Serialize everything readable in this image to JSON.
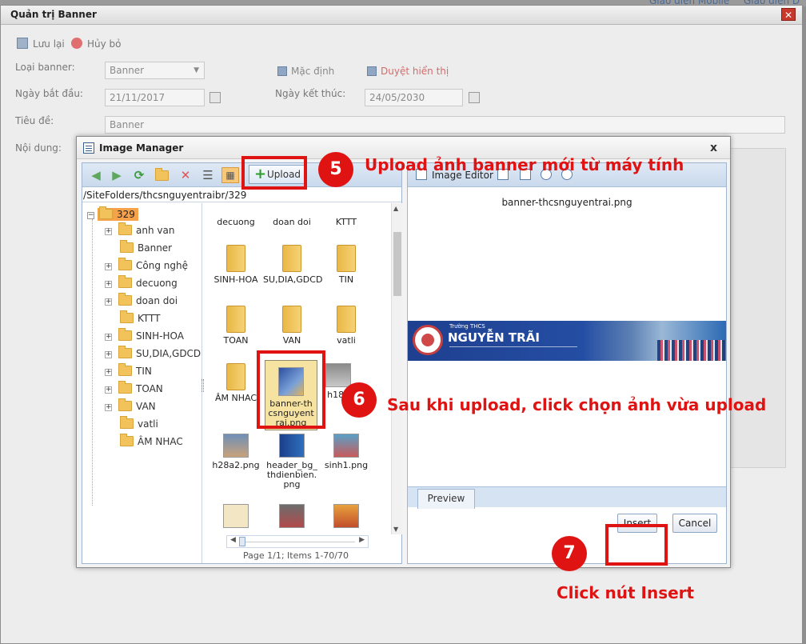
{
  "page": {
    "top_links": [
      "Giao diện Mobile",
      "Giao diện D"
    ]
  },
  "window": {
    "title": "Quản trị Banner",
    "close_glyph": "✕"
  },
  "toolbar": {
    "save_label": "Lưu lại",
    "cancel_label": "Hủy bỏ"
  },
  "form": {
    "banner_type_label": "Loại banner:",
    "banner_type_value": "Banner",
    "default_label": "Mặc định",
    "approve_label": "Duyệt hiển thị",
    "start_date_label": "Ngày bắt đầu:",
    "start_date_value": "21/11/2017",
    "end_date_label": "Ngày kết thúc:",
    "end_date_value": "24/05/2030",
    "title_label": "Tiêu đề:",
    "title_value": "Banner",
    "content_label": "Nội dung:"
  },
  "image_manager": {
    "title": "Image Manager",
    "close_glyph": "x",
    "upload_label": "Upload",
    "path": "/SiteFolders/thcsnguyentraibr/329",
    "tree": {
      "root": "329",
      "items": [
        {
          "label": "anh van",
          "expandable": true
        },
        {
          "label": "Banner",
          "expandable": false
        },
        {
          "label": "Công nghệ",
          "expandable": true
        },
        {
          "label": "decuong",
          "expandable": true
        },
        {
          "label": "doan doi",
          "expandable": true
        },
        {
          "label": "KTTT",
          "expandable": false
        },
        {
          "label": "SINH-HOA",
          "expandable": true
        },
        {
          "label": "SU,DIA,GDCD",
          "expandable": true
        },
        {
          "label": "TIN",
          "expandable": true
        },
        {
          "label": "TOAN",
          "expandable": true
        },
        {
          "label": "VAN",
          "expandable": true
        },
        {
          "label": "vatli",
          "expandable": false
        },
        {
          "label": "ÂM NHAC",
          "expandable": false
        }
      ]
    },
    "grid": {
      "row0": [
        "decuong",
        "doan doi",
        "KTTT"
      ],
      "row1": [
        "SINH-HOA",
        "SU,DIA,GDCD",
        "TIN"
      ],
      "row2": [
        "TOAN",
        "VAN",
        "vatli"
      ],
      "row3_folder": "ÂM NHAC",
      "selected_file": "banner-thcsnguyentrai.png",
      "row3_third": "h18a",
      "row4": [
        "h28a2.png",
        "header_bg_thdienbien.png",
        "sinh1.png"
      ]
    },
    "pager": "Page 1/1; Items 1-70/70",
    "image_editor_label": "Image Editor",
    "preview_filename": "banner-thcsnguyentrai.png",
    "banner": {
      "school_label": "Trường THCS",
      "school_name": "NGUYỄN TRÃI"
    },
    "preview_tab": "Preview",
    "insert_label": "Insert",
    "cancel_label": "Cancel"
  },
  "annotations": {
    "step5_number": "5",
    "step5_text": "Upload ảnh banner mới từ máy tính",
    "step6_number": "6",
    "step6_text": "Sau khi upload, click chọn ảnh vừa upload",
    "step7_number": "7",
    "step7_text": "Click nút Insert",
    "color": "#e01313"
  },
  "colors": {
    "selected_folder": "#f5a24a",
    "toolbar_blue": "#c9d9ec",
    "banner_blue": "#244ea3"
  }
}
